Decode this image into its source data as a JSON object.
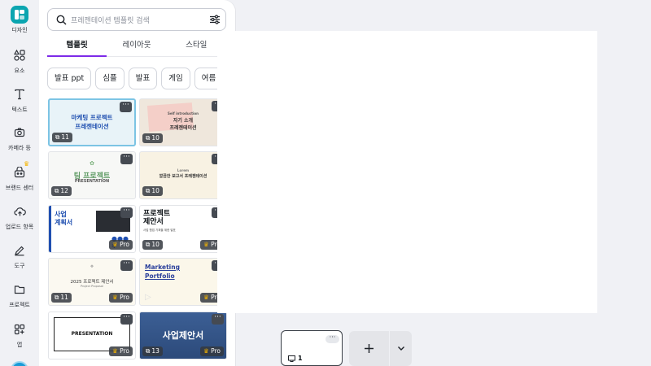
{
  "sidebar": {
    "items": [
      {
        "label": "디자인",
        "icon": "design-icon"
      },
      {
        "label": "요소",
        "icon": "elements-icon"
      },
      {
        "label": "텍스트",
        "icon": "text-icon"
      },
      {
        "label": "카메라 등",
        "icon": "camera-icon"
      },
      {
        "label": "브랜드 센터",
        "icon": "brand-icon"
      },
      {
        "label": "업로드 항목",
        "icon": "upload-icon"
      },
      {
        "label": "도구",
        "icon": "tools-icon"
      },
      {
        "label": "프로젝트",
        "icon": "folder-icon"
      },
      {
        "label": "앱",
        "icon": "apps-icon"
      }
    ]
  },
  "search": {
    "placeholder": "프레젠테이션 템플릿 검색"
  },
  "tabs": [
    "템플릿",
    "레이아웃",
    "스타일"
  ],
  "chips": [
    "발표 ppt",
    "심플",
    "발표",
    "게임",
    "여름"
  ],
  "templates": [
    {
      "count": "11",
      "title": "마케팅 프로젝트\n프레젠테이션",
      "pro": false
    },
    {
      "count": "10",
      "title": "자기 소개\n프레젠테이션",
      "subtitle": "Self introduction",
      "pro": false
    },
    {
      "count": "12",
      "title": "팀 프로젝트",
      "subtitle": "PRESENTATION",
      "pro": false
    },
    {
      "count": "10",
      "title": "깔끔한 보고서 프레젠테이션",
      "subtitle": "Lorem",
      "pro": false
    },
    {
      "count": "",
      "title": "사업\n계획서",
      "pro": true,
      "pro_label": "Pro"
    },
    {
      "count": "10",
      "title": "프로젝트\n제안서",
      "subtitle": "사업 협업 기획을 위한 발표",
      "pro": true,
      "pro_label": "Pro"
    },
    {
      "count": "11",
      "title": "2025 프로젝트 제안서",
      "subtitle": "Project Proposal",
      "pro": true,
      "pro_label": "Pro"
    },
    {
      "count": "",
      "title": "Marketing\nPortfolio",
      "pro": true,
      "pro_label": "Pro"
    },
    {
      "count": "",
      "title": "PRESENTATION",
      "pro": true,
      "pro_label": "Pro"
    },
    {
      "count": "13",
      "title": "사업제안서",
      "pro": true,
      "pro_label": "Pro"
    }
  ],
  "pages": {
    "current": "1"
  },
  "colors": {
    "accent": "#7d2ae8",
    "brand": "#0ba5b0"
  }
}
